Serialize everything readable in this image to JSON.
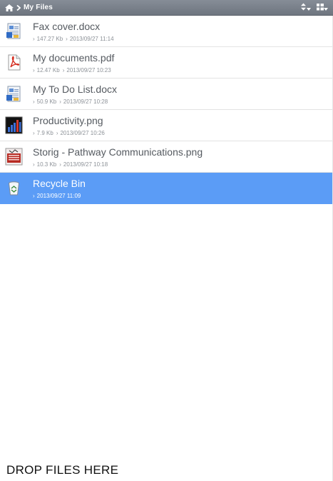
{
  "header": {
    "breadcrumb": "My Files",
    "home_icon": "home-icon",
    "sort_icon": "sort-icon",
    "view_icon": "grid-view-icon",
    "bar_color": "#7a818b"
  },
  "files": [
    {
      "name": "Fax cover.docx",
      "size": "147.27 Kb",
      "date": "2013/09/27 11:14",
      "icon": "docx-icon"
    },
    {
      "name": "My documents.pdf",
      "size": "12.47 Kb",
      "date": "2013/09/27 10:23",
      "icon": "pdf-icon"
    },
    {
      "name": "My To Do List.docx",
      "size": "50.9 Kb",
      "date": "2013/09/27 10:28",
      "icon": "docx-icon"
    },
    {
      "name": "Productivity.png",
      "size": "7.9 Kb",
      "date": "2013/09/27 10:26",
      "icon": "image-icon"
    },
    {
      "name": "Storig - Pathway Communications.png",
      "size": "10.3 Kb",
      "date": "2013/09/27 10:18",
      "icon": "image-icon"
    },
    {
      "name": "Recycle Bin",
      "date": "2013/09/27 11:09",
      "icon": "recycle-bin-icon",
      "selected": true
    }
  ],
  "selected_color": "#5b9cf6",
  "dropzone": {
    "label": "DROP FILES HERE"
  }
}
